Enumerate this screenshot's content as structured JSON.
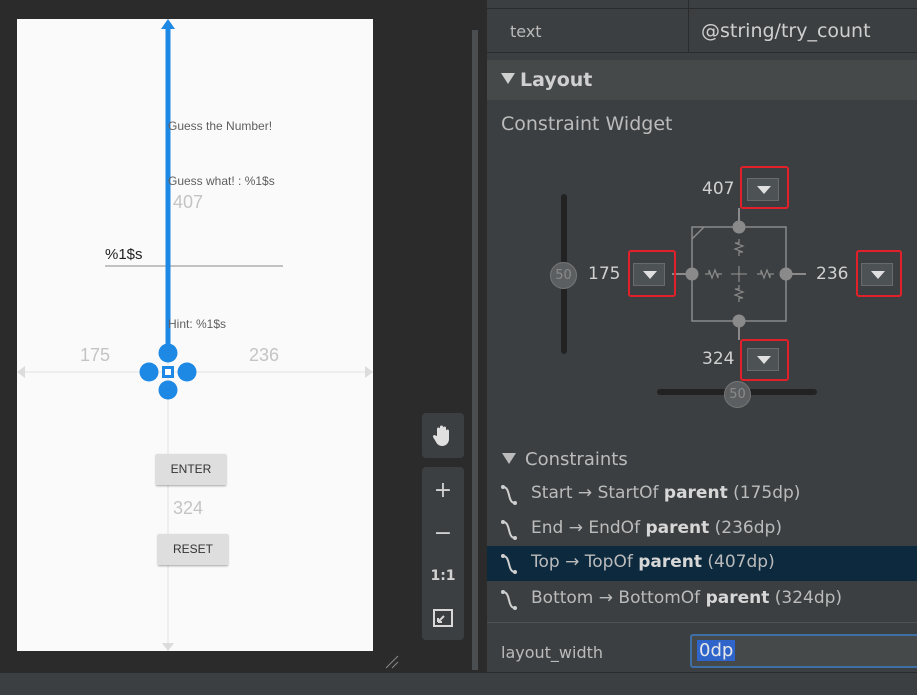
{
  "phone": {
    "title_text": "Guess the Number!",
    "guess_text": "Guess what! : %1$s",
    "top_margin": "407",
    "edit_text": "%1$s",
    "hint_text": "Hint: %1$s",
    "start_margin": "175",
    "end_margin": "236",
    "bottom_margin": "324",
    "enter_label": "ENTER",
    "reset_label": "RESET"
  },
  "toolbar": {
    "pan_icon": "hand-icon",
    "zoom_in": "+",
    "zoom_out": "−",
    "actual_size": "1:1",
    "fit_icon": "fit-screen-icon"
  },
  "panel": {
    "text_attr_name": "text",
    "text_attr_value": "@string/try_count",
    "layout_section": "Layout",
    "constraint_widget_title": "Constraint Widget",
    "widget": {
      "top": "407",
      "start": "175",
      "end": "236",
      "bottom": "324",
      "vertical_bias": "50",
      "horizontal_bias": "50"
    },
    "constraints_section": "Constraints",
    "constraints": [
      {
        "side": "Start",
        "target": "StartOf",
        "anchor": "parent",
        "margin": "(175dp)"
      },
      {
        "side": "End",
        "target": "EndOf",
        "anchor": "parent",
        "margin": "(236dp)"
      },
      {
        "side": "Top",
        "target": "TopOf",
        "anchor": "parent",
        "margin": "(407dp)"
      },
      {
        "side": "Bottom",
        "target": "BottomOf",
        "anchor": "parent",
        "margin": "(324dp)"
      }
    ],
    "layout_width_label": "layout_width",
    "layout_width_value": "0dp"
  },
  "colors": {
    "accent": "#1e88e5",
    "highlight_row": "#0d293e",
    "red_outline": "#e2202a",
    "panel_bg": "#3c3f41"
  }
}
